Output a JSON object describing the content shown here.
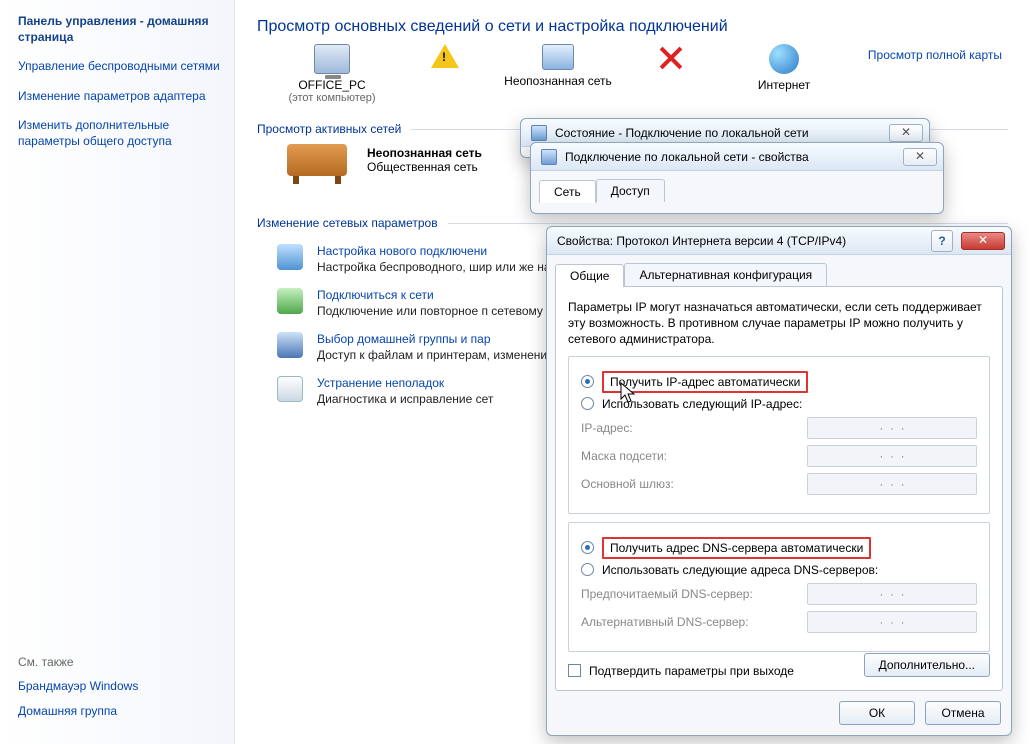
{
  "sidebar": {
    "home": "Панель управления - домашняя страница",
    "links": [
      "Управление беспроводными сетями",
      "Изменение параметров адаптера",
      "Изменить дополнительные параметры общего доступа"
    ],
    "see_also_hd": "См. также",
    "see_also": [
      "Брандмауэр Windows",
      "Домашняя группа"
    ]
  },
  "main": {
    "title": "Просмотр основных сведений о сети и настройка подключений",
    "full_map": "Просмотр полной карты",
    "net": {
      "pc": "OFFICE_PC",
      "pc_sub": "(этот компьютер)",
      "unknown": "Неопознанная сеть",
      "internet": "Интернет"
    },
    "sec_active": "Просмотр активных сетей",
    "bench_name": "Неопознанная сеть",
    "bench_type": "Общественная сеть",
    "sec_params": "Изменение сетевых параметров",
    "tasks": [
      {
        "title": "Настройка нового подключени",
        "desc": "Настройка беспроводного, шир\nили же настройка маршрутизат"
      },
      {
        "title": "Подключиться к сети",
        "desc": "Подключение или повторное п\nсетевому соединению или под"
      },
      {
        "title": "Выбор домашней группы и пар",
        "desc": "Доступ к файлам и принтерам,\nизменение параметров общего"
      },
      {
        "title": "Устранение неполадок",
        "desc": "Диагностика и исправление сет"
      }
    ]
  },
  "win_status": {
    "title": "Состояние - Подключение по локальной сети"
  },
  "win_props": {
    "title": "Подключение по локальной сети - свойства",
    "tabs": [
      "Сеть",
      "Доступ"
    ]
  },
  "win_ipv4": {
    "title": "Свойства: Протокол Интернета версии 4 (TCP/IPv4)",
    "tabs": [
      "Общие",
      "Альтернативная конфигурация"
    ],
    "intro": "Параметры IP могут назначаться автоматически, если сеть поддерживает эту возможность. В противном случае параметры IP можно получить у сетевого администратора.",
    "r_ip_auto": "Получить IP-адрес автоматически",
    "r_ip_manual": "Использовать следующий IP-адрес:",
    "f_ip": "IP-адрес:",
    "f_mask": "Маска подсети:",
    "f_gw": "Основной шлюз:",
    "r_dns_auto": "Получить адрес DNS-сервера автоматически",
    "r_dns_manual": "Использовать следующие адреса DNS-серверов:",
    "f_dns1": "Предпочитаемый DNS-сервер:",
    "f_dns2": "Альтернативный DNS-сервер:",
    "chk_confirm": "Подтвердить параметры при выходе",
    "btn_adv": "Дополнительно...",
    "btn_ok": "ОК",
    "btn_cancel": "Отмена"
  }
}
